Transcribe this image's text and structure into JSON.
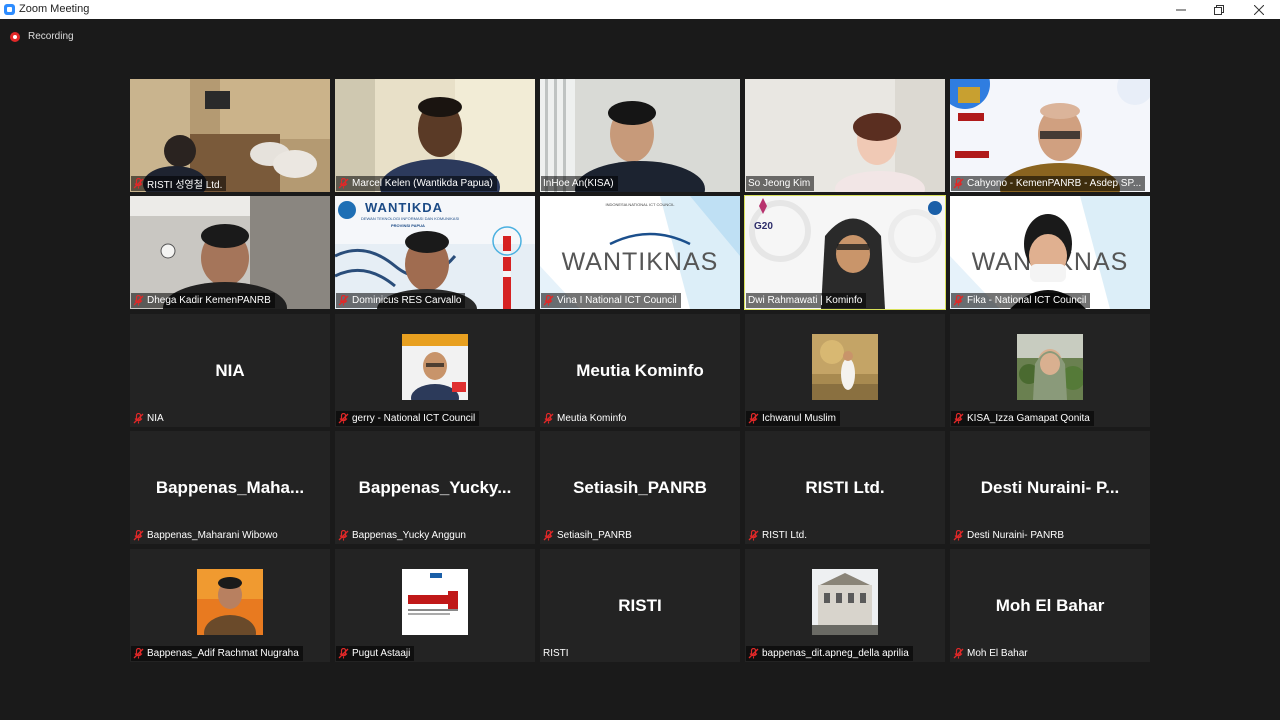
{
  "window": {
    "title": "Zoom Meeting"
  },
  "recording": {
    "label": "Recording"
  },
  "colors": {
    "mute": "#e02828",
    "active_speaker": "#d8e05a",
    "tile_bg": "#232323",
    "background": "#1a1a1a"
  },
  "tiles": [
    {
      "label": "RISTI 성영철 Ltd.",
      "muted": true
    },
    {
      "label": "Marcel Kelen (Wantikda Papua)",
      "muted": true
    },
    {
      "label": "InHoe An(KISA)",
      "muted": false
    },
    {
      "label": "So Jeong Kim",
      "muted": false
    },
    {
      "label": "Cahyono - KemenPANRB - Asdep SP...",
      "muted": true
    },
    {
      "label": "Dhega Kadir KemenPANRB",
      "muted": true
    },
    {
      "label": "Dominicus RES Carvallo",
      "muted": true,
      "banner_title": "WANTIKDA",
      "banner_sub": "DEWAN TEKNOLOGI INFORMASI DAN KOMUNIKASI",
      "banner_sub2": "PROVINSI PAPUA"
    },
    {
      "label": "Vina I National ICT Council",
      "muted": true,
      "banner_title": "WANTIKNAS",
      "banner_sub": "INDONESIA NATIONAL ICT COUNCIL"
    },
    {
      "label": "Dwi Rahmawati | Kominfo",
      "muted": false,
      "active": true,
      "badge": "G20"
    },
    {
      "label": "Fika - National ICT Council",
      "muted": true,
      "banner_title": "WANTIKNAS"
    },
    {
      "label": "NIA",
      "muted": true,
      "big": "NIA"
    },
    {
      "label": "gerry - National ICT Council",
      "muted": true
    },
    {
      "label": "Meutia Kominfo",
      "muted": true,
      "big": "Meutia Kominfo"
    },
    {
      "label": "Ichwanul Muslim",
      "muted": true
    },
    {
      "label": "KISA_Izza Gamapat Qonita",
      "muted": true
    },
    {
      "label": "Bappenas_Maharani Wibowo",
      "muted": true,
      "big": "Bappenas_Maha..."
    },
    {
      "label": "Bappenas_Yucky Anggun",
      "muted": true,
      "big": "Bappenas_Yucky..."
    },
    {
      "label": "Setiasih_PANRB",
      "muted": true,
      "big": "Setiasih_PANRB"
    },
    {
      "label": "RISTI Ltd.",
      "muted": true,
      "big": "RISTI Ltd."
    },
    {
      "label": "Desti Nuraini- PANRB",
      "muted": true,
      "big": "Desti Nuraini- P..."
    },
    {
      "label": "Bappenas_Adif Rachmat Nugraha",
      "muted": true
    },
    {
      "label": "Pugut Astaaji",
      "muted": true
    },
    {
      "label": "RISTI",
      "muted": false,
      "big": "RISTI"
    },
    {
      "label": "bappenas_dit.apneg_della aprilia",
      "muted": true
    },
    {
      "label": "Moh El Bahar",
      "muted": true,
      "big": "Moh El Bahar"
    }
  ]
}
